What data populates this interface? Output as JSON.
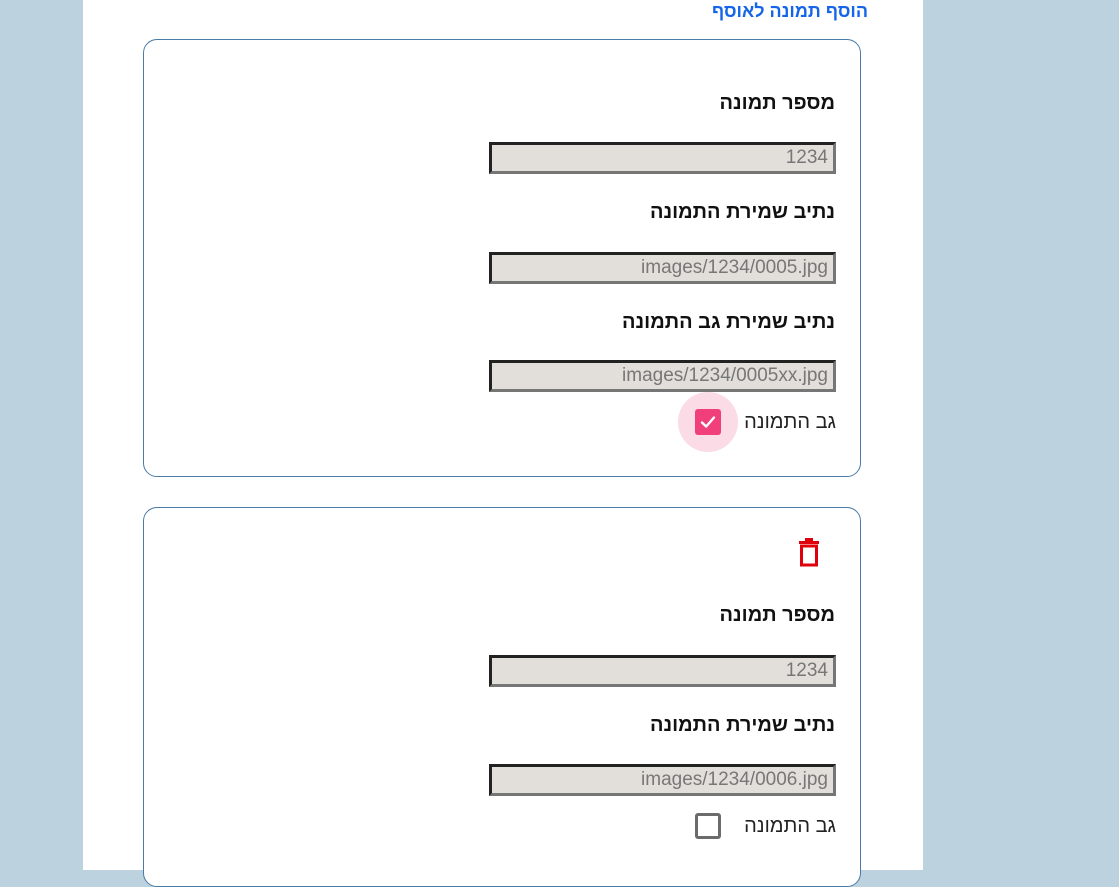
{
  "header": {
    "add_image_link": "הוסף תמונה לאוסף"
  },
  "cards": [
    {
      "image_number_label": "מספר תמונה",
      "image_number_value": "1234",
      "image_path_label": "נתיב שמירת התמונה",
      "image_path_value": "images/1234/0005.jpg",
      "back_path_label": "נתיב שמירת גב התמונה",
      "back_path_value": "images/1234/0005xx.jpg",
      "back_checkbox_label": "גב התמונה",
      "back_checked": true
    },
    {
      "image_number_label": "מספר תמונה",
      "image_number_value": "1234",
      "image_path_label": "נתיב שמירת התמונה",
      "image_path_value": "images/1234/0006.jpg",
      "back_checkbox_label": "גב התמונה",
      "back_checked": false,
      "delete_icon": "trash-icon"
    }
  ],
  "colors": {
    "link": "#1565e8",
    "card_border": "#4a7aa8",
    "checkbox_checked": "#f03f7b",
    "delete_icon": "#e0000c",
    "input_bg": "#e2dfda",
    "page_bg": "#bcd2df"
  }
}
